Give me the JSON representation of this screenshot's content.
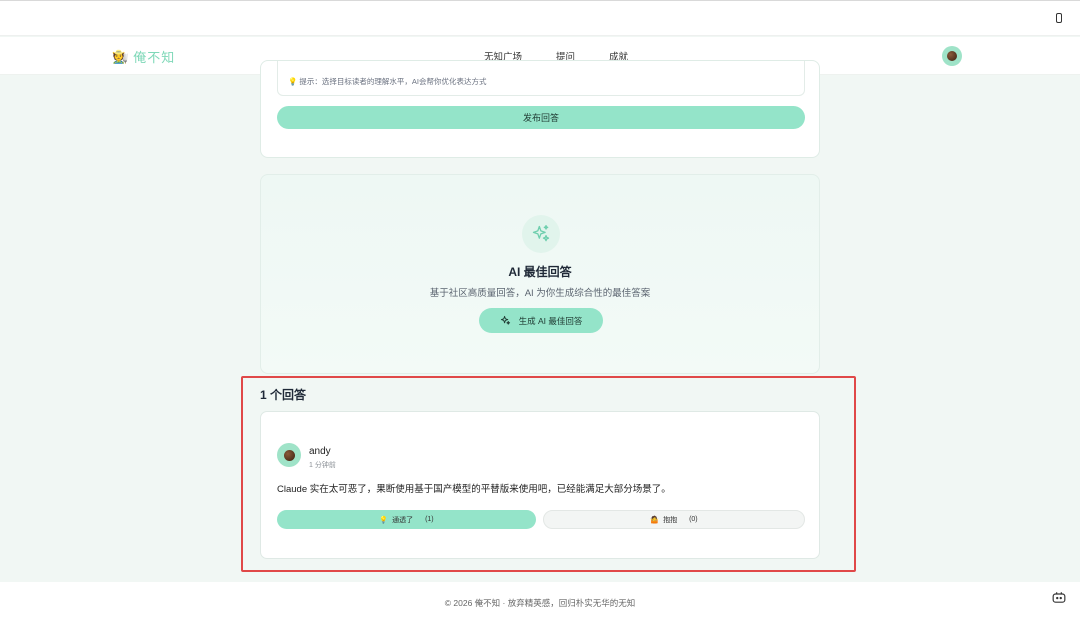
{
  "header": {
    "brand_icon": "🧑‍🌾",
    "brand_name": "俺不知",
    "nav": [
      "无知广场",
      "提问",
      "成就"
    ]
  },
  "publish": {
    "hint": "💡 提示：选择目标读者的理解水平，AI会帮你优化表达方式",
    "button": "发布回答"
  },
  "ai_best": {
    "title": "AI 最佳回答",
    "subtitle": "基于社区高质量回答，AI 为你生成综合性的最佳答案",
    "button": "生成 AI 最佳回答"
  },
  "answers": {
    "heading": "1 个回答",
    "items": [
      {
        "author": "andy",
        "time": "1 分钟前",
        "body": "Claude 实在太可恶了，果断使用基于国产模型的平替版来使用吧，已经能满足大部分场景了。",
        "vote_up": {
          "emoji": "💡",
          "label": "通透了",
          "count": "(1)"
        },
        "vote_down": {
          "emoji": "🤷",
          "label": "抱抱",
          "count": "(0)"
        }
      }
    ]
  },
  "footer": {
    "text": "© 2026 俺不知 · 放弃精英感，回归朴实无华的无知"
  },
  "colors": {
    "accent": "#94e4c9",
    "brand": "#7fd8b8",
    "highlight": "#e04848"
  }
}
